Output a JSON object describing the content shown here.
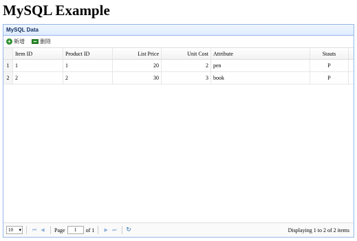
{
  "page": {
    "title": "MySQL Example"
  },
  "panel": {
    "title": "MySQL Data"
  },
  "toolbar": {
    "add_label": "新增",
    "delete_label": "删除"
  },
  "grid": {
    "columns": [
      "Item ID",
      "Product ID",
      "List Price",
      "Unit Cost",
      "Attribute",
      "Stauts"
    ],
    "rows": [
      {
        "rn": "1",
        "item_id": "1",
        "product_id": "1",
        "list_price": "20",
        "unit_cost": "2",
        "attribute": "pen",
        "status": "P"
      },
      {
        "rn": "2",
        "item_id": "2",
        "product_id": "2",
        "list_price": "30",
        "unit_cost": "3",
        "attribute": "book",
        "status": "P"
      }
    ]
  },
  "pager": {
    "page_size": "10",
    "page_label": "Page",
    "page_value": "1",
    "of_label": "of 1",
    "display_info": "Displaying 1 to 2 of 2 items"
  }
}
